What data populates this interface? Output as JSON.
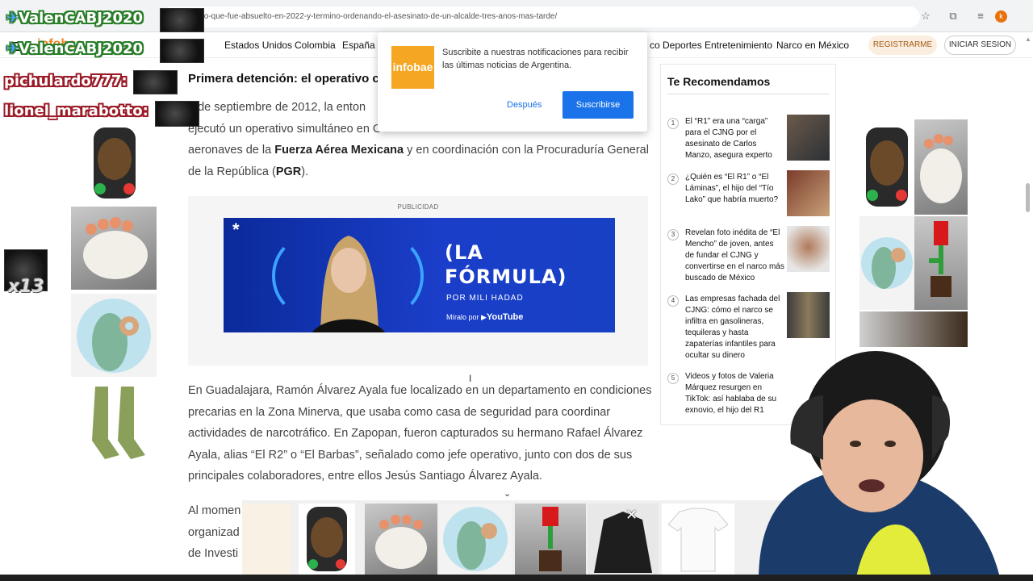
{
  "browser": {
    "url": "r1-el-narco-que-fue-absuelto-en-2022-y-termino-ordenando-el-asesinato-de-un-alcalde-tres-anos-mas-tarde/",
    "profile_initial": "k"
  },
  "site": {
    "logo": "infobae",
    "nav": [
      "Estados Unidos",
      "Colombia",
      "España",
      "co Deportes",
      "Entretenimiento",
      "Narco en México"
    ],
    "register_label": "REGISTRARME",
    "login_label": "INICIAR SESION"
  },
  "article": {
    "heading": "Primera detención: el operativo c",
    "para1_a": "6 de septiembre de 2012, la enton",
    "para1_b": "ejecutó un operativo simultáneo en G",
    "para1_c": "aeronaves de la ",
    "para1_bold1": "Fuerza Aérea Mexicana",
    "para1_d": " y en coordinación con la Procuraduría General",
    "para1_e": "de la República (",
    "para1_bold2": "PGR",
    "para1_f": ").",
    "para2": "En Guadalajara, Ramón Álvarez Ayala fue localizado en un departamento en condiciones precarias en la Zona Minerva, que usaba como casa de seguridad para coordinar actividades de narcotráfico. En Zapopan, fueron capturados su hermano Rafael Álvarez Ayala, alias “El R2” o “El Barbas”, señalado como jefe operativo, junto con dos de sus principales colaboradores, entre ellos Jesús Santiago Álvarez Ayala.",
    "para3_a": "Al momen",
    "para3_b": "organizad",
    "para3_c": "de Investi"
  },
  "ad": {
    "label": "PUBLICIDAD",
    "title_line1": "(LA",
    "title_line2": "FÓRMULA)",
    "subtitle": "POR MILI HADAD",
    "watch_on": "Míralo por",
    "youtube": "YouTube"
  },
  "popup": {
    "logo": "infobae",
    "message": "Suscribite a nuestras notificaciones para recibir las últimas noticias de Argentina.",
    "later_label": "Después",
    "subscribe_label": "Suscribirse"
  },
  "recommended": {
    "title": "Te Recomendamos",
    "items": [
      {
        "num": "1",
        "text": "El “R1” era una “carga” para el CJNG por el asesinato de Carlos Manzo, asegura experto"
      },
      {
        "num": "2",
        "text": "¿Quién es “El R1” o “El Láminas”, el hijo del “Tío Lako” que habría muerto?"
      },
      {
        "num": "3",
        "text": "Revelan foto inédita de “El Mencho” de joven, antes de fundar el CJNG y convertirse en el narco más buscado de México"
      },
      {
        "num": "4",
        "text": "Las empresas fachada del CJNG: cómo el narco se infiltra en gasolineras, tequileras y hasta zapaterías infantiles para ocultar su dinero"
      },
      {
        "num": "5",
        "text": "Videos y fotos de Valeria Márquez resurgen en TikTok: así hablaba de su exnovio, el hijo del R1"
      }
    ]
  },
  "overlay": {
    "chat_names": [
      "ValenCABJ2020",
      "ValenCABJ2020",
      "pichulardo777",
      "lionel_marabotto"
    ],
    "counter": "x13"
  }
}
